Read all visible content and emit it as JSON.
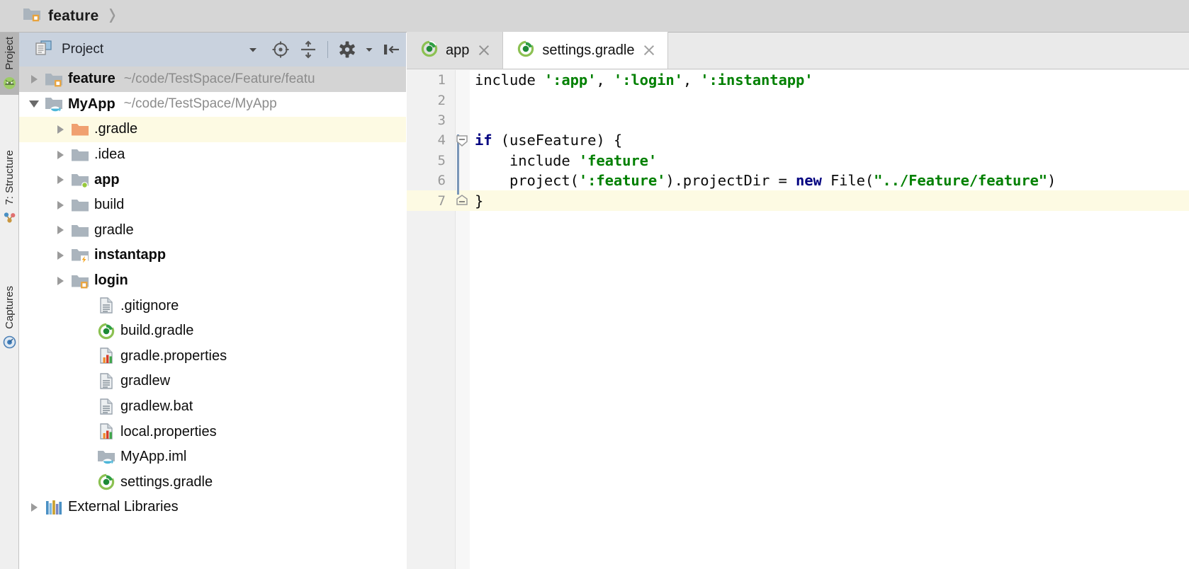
{
  "breadcrumb": {
    "items": [
      {
        "label": "feature",
        "icon": "module-folder-icon"
      }
    ],
    "separator": "›"
  },
  "tool_strip": {
    "buttons": [
      {
        "label": "Project",
        "icon": "android-studio-icon",
        "selected": true
      },
      {
        "label": "7: Structure",
        "icon": "structure-graph-icon",
        "selected": false
      },
      {
        "label": "Captures",
        "icon": "captures-target-icon",
        "selected": false
      }
    ]
  },
  "project_panel": {
    "title": "Project",
    "toolbar": [
      {
        "name": "view-mode-chevron",
        "icon": "chevron-down-icon"
      },
      {
        "name": "scroll-from-source",
        "icon": "target-icon"
      },
      {
        "name": "collapse-all",
        "icon": "collapse-all-icon"
      },
      {
        "name": "settings",
        "icon": "gear-icon"
      },
      {
        "name": "hide-panel",
        "icon": "hide-left-icon"
      }
    ],
    "tree": [
      {
        "label": "feature",
        "path": "~/code/TestSpace/Feature/featu",
        "icon": "module-folder-icon",
        "indent": 0,
        "arrow": "closed",
        "bold": true,
        "state": "selected-gray"
      },
      {
        "label": "MyApp",
        "path": "~/code/TestSpace/MyApp",
        "icon": "java-module-folder-icon",
        "indent": 0,
        "arrow": "open",
        "bold": true,
        "state": "none"
      },
      {
        "label": ".gradle",
        "path": "",
        "icon": "orange-folder-icon",
        "indent": 1,
        "arrow": "closed",
        "bold": false,
        "state": "highlight-yellow"
      },
      {
        "label": ".idea",
        "path": "",
        "icon": "gray-folder-icon",
        "indent": 1,
        "arrow": "closed",
        "bold": false,
        "state": "none"
      },
      {
        "label": "app",
        "path": "",
        "icon": "android-module-folder-icon",
        "indent": 1,
        "arrow": "closed",
        "bold": true,
        "state": "none"
      },
      {
        "label": "build",
        "path": "",
        "icon": "gray-folder-icon",
        "indent": 1,
        "arrow": "closed",
        "bold": false,
        "state": "none"
      },
      {
        "label": "gradle",
        "path": "",
        "icon": "gray-folder-icon",
        "indent": 1,
        "arrow": "closed",
        "bold": false,
        "state": "none"
      },
      {
        "label": "instantapp",
        "path": "",
        "icon": "instantapp-folder-icon",
        "indent": 1,
        "arrow": "closed",
        "bold": true,
        "state": "none"
      },
      {
        "label": "login",
        "path": "",
        "icon": "module-folder-icon",
        "indent": 1,
        "arrow": "closed",
        "bold": true,
        "state": "none"
      },
      {
        "label": ".gitignore",
        "path": "",
        "icon": "text-file-icon",
        "indent": 2,
        "arrow": "none",
        "bold": false,
        "state": "none"
      },
      {
        "label": "build.gradle",
        "path": "",
        "icon": "gradle-file-icon",
        "indent": 2,
        "arrow": "none",
        "bold": false,
        "state": "none"
      },
      {
        "label": "gradle.properties",
        "path": "",
        "icon": "properties-file-icon",
        "indent": 2,
        "arrow": "none",
        "bold": false,
        "state": "none"
      },
      {
        "label": "gradlew",
        "path": "",
        "icon": "text-file-icon",
        "indent": 2,
        "arrow": "none",
        "bold": false,
        "state": "none"
      },
      {
        "label": "gradlew.bat",
        "path": "",
        "icon": "text-file-icon",
        "indent": 2,
        "arrow": "none",
        "bold": false,
        "state": "none"
      },
      {
        "label": "local.properties",
        "path": "",
        "icon": "properties-file-icon",
        "indent": 2,
        "arrow": "none",
        "bold": false,
        "state": "none"
      },
      {
        "label": "MyApp.iml",
        "path": "",
        "icon": "iml-file-icon",
        "indent": 2,
        "arrow": "none",
        "bold": false,
        "state": "none"
      },
      {
        "label": "settings.gradle",
        "path": "",
        "icon": "gradle-file-icon",
        "indent": 2,
        "arrow": "none",
        "bold": false,
        "state": "none"
      },
      {
        "label": "External Libraries",
        "path": "",
        "icon": "libraries-icon",
        "indent": 0,
        "arrow": "closed",
        "bold": false,
        "state": "none"
      }
    ]
  },
  "editor": {
    "tabs": [
      {
        "label": "app",
        "icon": "gradle-file-icon",
        "active": false,
        "closable": true
      },
      {
        "label": "settings.gradle",
        "icon": "gradle-file-icon",
        "active": true,
        "closable": true
      }
    ],
    "caret_line": 7,
    "code_lines": [
      {
        "num": "1",
        "tokens": [
          {
            "t": "include ",
            "c": "plain"
          },
          {
            "t": "':app'",
            "c": "string"
          },
          {
            "t": ", ",
            "c": "plain"
          },
          {
            "t": "':login'",
            "c": "string"
          },
          {
            "t": ", ",
            "c": "plain"
          },
          {
            "t": "':instantapp'",
            "c": "string"
          }
        ]
      },
      {
        "num": "2",
        "tokens": []
      },
      {
        "num": "3",
        "tokens": []
      },
      {
        "num": "4",
        "tokens": [
          {
            "t": "if",
            "c": "keyword"
          },
          {
            "t": " (useFeature) {",
            "c": "plain"
          }
        ]
      },
      {
        "num": "5",
        "tokens": [
          {
            "t": "    include ",
            "c": "plain"
          },
          {
            "t": "'feature'",
            "c": "string"
          }
        ]
      },
      {
        "num": "6",
        "tokens": [
          {
            "t": "    project(",
            "c": "plain"
          },
          {
            "t": "':feature'",
            "c": "string"
          },
          {
            "t": ").projectDir = ",
            "c": "plain"
          },
          {
            "t": "new",
            "c": "keyword"
          },
          {
            "t": " File(",
            "c": "plain"
          },
          {
            "t": "\"../Feature/feature\"",
            "c": "string"
          },
          {
            "t": ")",
            "c": "plain"
          }
        ]
      },
      {
        "num": "7",
        "tokens": [
          {
            "t": "}",
            "c": "plain"
          }
        ]
      }
    ]
  },
  "colors": {
    "breadcrumb_bg": "#d6d6d6",
    "panel_header_bg": "#c9d2de",
    "selection_gray": "#d4d4d4",
    "caret_line": "#fdfae3",
    "string_green": "#008000",
    "keyword_blue": "#000080",
    "gradle_green": "#3c9a3c",
    "folder_gray": "#aab4bd",
    "folder_orange": "#f0a070"
  }
}
